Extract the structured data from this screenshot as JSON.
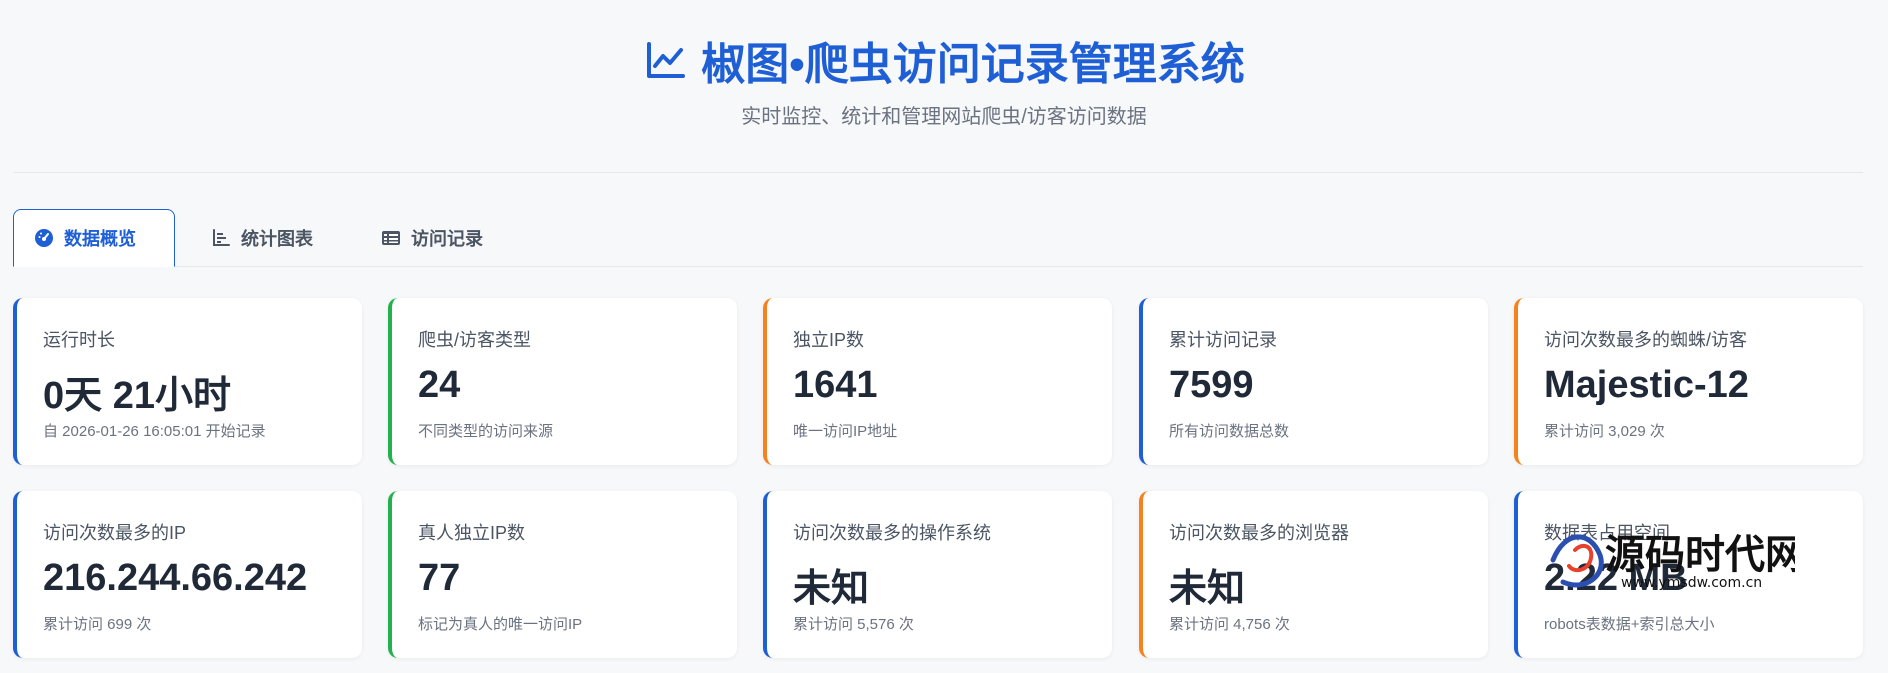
{
  "header": {
    "title": "椒图•爬虫访问记录管理系统",
    "subtitle": "实时监控、统计和管理网站爬虫/访客访问数据",
    "title_icon": "line-chart-icon",
    "accent_color": "#1f5fd6"
  },
  "tabs": [
    {
      "label": "数据概览",
      "icon": "dashboard-icon",
      "active": true
    },
    {
      "label": "统计图表",
      "icon": "bar-chart-icon",
      "active": false
    },
    {
      "label": "访问记录",
      "icon": "table-list-icon",
      "active": false
    }
  ],
  "cards": [
    {
      "label": "运行时长",
      "value": "0天 21小时",
      "note": "自 2026-01-26 16:05:01 开始记录",
      "color": "#1f5fd6"
    },
    {
      "label": "爬虫/访客类型",
      "value": "24",
      "note": "不同类型的访问来源",
      "color": "#22b14c"
    },
    {
      "label": "独立IP数",
      "value": "1641",
      "note": "唯一访问IP地址",
      "color": "#f5821f"
    },
    {
      "label": "累计访问记录",
      "value": "7599",
      "note": "所有访问数据总数",
      "color": "#1f5fd6"
    },
    {
      "label": "访问次数最多的蜘蛛/访客",
      "value": "Majestic-12",
      "note": "累计访问 3,029 次",
      "color": "#f5821f"
    },
    {
      "label": "访问次数最多的IP",
      "value": "216.244.66.242",
      "note": "累计访问 699 次",
      "color": "#1f5fd6"
    },
    {
      "label": "真人独立IP数",
      "value": "77",
      "note": "标记为真人的唯一访问IP",
      "color": "#22b14c"
    },
    {
      "label": "访问次数最多的操作系统",
      "value": "未知",
      "note": "累计访问 5,576 次",
      "color": "#1f5fd6"
    },
    {
      "label": "访问次数最多的浏览器",
      "value": "未知",
      "note": "累计访问 4,756 次",
      "color": "#f5821f"
    },
    {
      "label": "数据表占用空间",
      "value": "2.22 MB",
      "note": "robots表数据+索引总大小",
      "color": "#1f5fd6"
    }
  ],
  "watermark": {
    "brand": "源码时代网",
    "domain": "www.ymsdw.com.cn"
  }
}
